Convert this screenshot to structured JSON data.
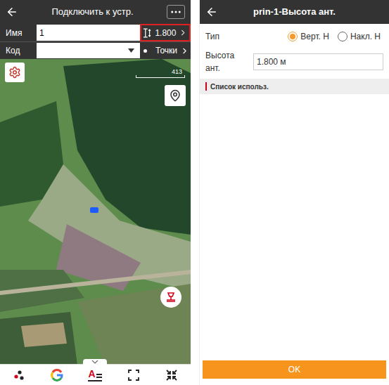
{
  "left": {
    "header": {
      "title": "Подключить к устр."
    },
    "name_field": {
      "label": "Имя",
      "value": "1"
    },
    "antenna": {
      "value": "1.800",
      "highlighted": true
    },
    "code_field": {
      "label": "Код",
      "value": ""
    },
    "points": {
      "label": "Точки"
    },
    "map": {
      "scale": "413"
    },
    "toolbar": [
      {
        "kind": "points"
      },
      {
        "kind": "google"
      },
      {
        "kind": "text",
        "glyph": "A"
      },
      {
        "kind": "fullscreen"
      },
      {
        "kind": "collapse"
      }
    ]
  },
  "right": {
    "header": {
      "title": "prin-1-Высота ант."
    },
    "type_label": "Тип",
    "type_options": [
      {
        "label": "Верт. H",
        "selected": true
      },
      {
        "label": "Накл. H",
        "selected": false
      }
    ],
    "height_label": "Высота ант.",
    "height_value": "1.800 м",
    "section": "Список использ.",
    "buttons": [
      "OK"
    ]
  }
}
